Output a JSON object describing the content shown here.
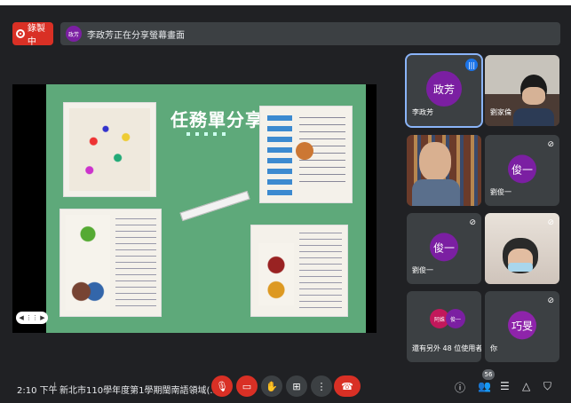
{
  "recording": {
    "label": "錄製中"
  },
  "presenting": {
    "avatar_text": "政芳",
    "banner": "李政芳正在分享螢幕畫面"
  },
  "slide": {
    "title": "任務單分享",
    "page_indicator": "◀ ⋮⋮ ▶"
  },
  "participants": [
    {
      "name": "李政芳",
      "avatar": "政芳",
      "speaking": true
    },
    {
      "name": "劉家倫",
      "video": true
    },
    {
      "name": "",
      "video": true
    },
    {
      "name": "劉俊一",
      "avatar": "俊一",
      "muted": true
    },
    {
      "name": "劉俊一",
      "avatar": "俊一",
      "muted": true
    },
    {
      "name": "",
      "video": true
    },
    {
      "name": "還有另外 48 位使用者",
      "stacked": [
        "阿姝",
        "俊一"
      ]
    },
    {
      "name": "你",
      "avatar": "巧旻",
      "muted": true
    }
  ],
  "bottom": {
    "time": "2:10 下午",
    "separator": "|",
    "meeting_title": "新北市110學年度第1學期閩南語領域(...",
    "participant_count": "56"
  },
  "colors": {
    "record_red": "#d93025",
    "avatar_purple": "#7b1fa2",
    "slide_green": "#5ea97a",
    "tile_bg": "#3c4043"
  },
  "icons": [
    "record-icon",
    "mic-off-icon",
    "camera-off-icon",
    "raise-hand-icon",
    "present-icon",
    "more-icon",
    "hangup-icon",
    "info-icon",
    "people-icon",
    "chat-icon",
    "activities-icon",
    "host-controls-icon"
  ]
}
